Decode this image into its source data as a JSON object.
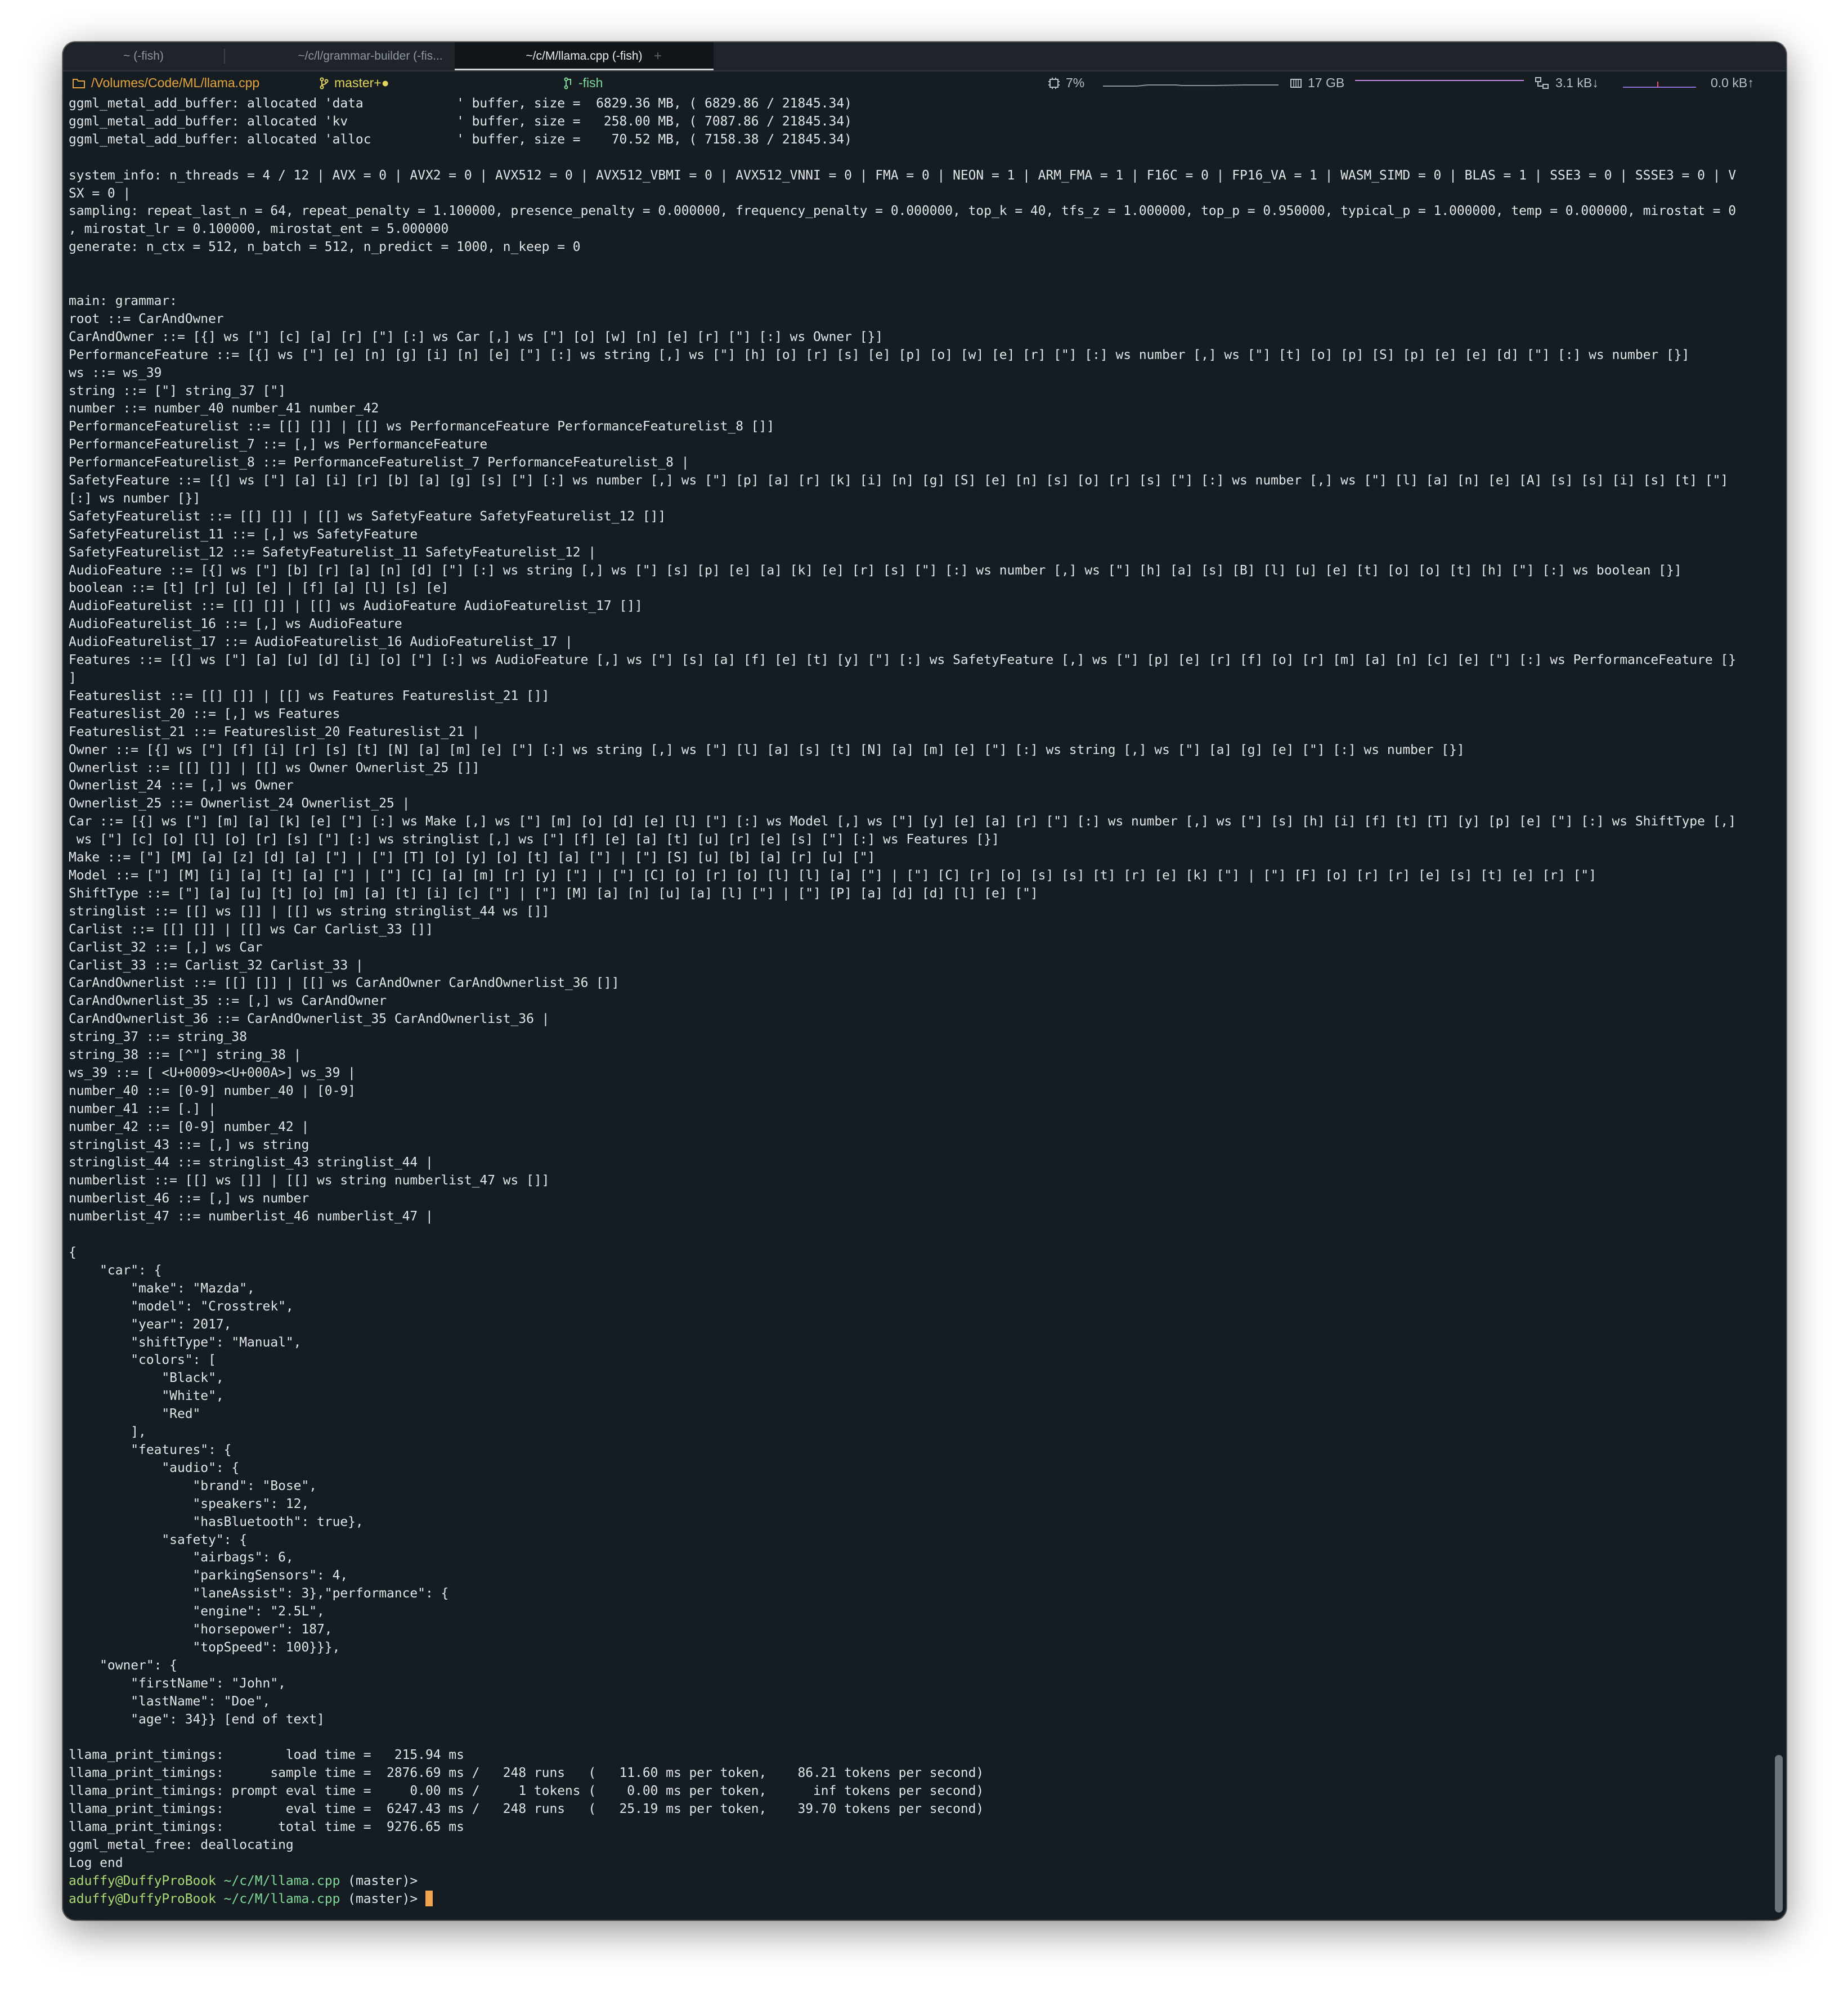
{
  "tabs": [
    {
      "label": "~ (-fish)",
      "active": false
    },
    {
      "label": "~/c/l/grammar-builder (-fis...",
      "active": false
    },
    {
      "label": "~/c/M/llama.cpp (-fish)",
      "active": true
    }
  ],
  "new_tab_label": "+",
  "status": {
    "path": "/Volumes/Code/ML/llama.cpp",
    "git": "master+●",
    "process": "-fish",
    "cpu": "7%",
    "memory": "17 GB",
    "net_down": "3.1 kB↓",
    "net_up": "0.0 kB↑"
  },
  "terminal": {
    "lines": [
      "ggml_metal_add_buffer: allocated 'data            ' buffer, size =  6829.36 MB, ( 6829.86 / 21845.34)",
      "ggml_metal_add_buffer: allocated 'kv              ' buffer, size =   258.00 MB, ( 7087.86 / 21845.34)",
      "ggml_metal_add_buffer: allocated 'alloc           ' buffer, size =    70.52 MB, ( 7158.38 / 21845.34)",
      "",
      "system_info: n_threads = 4 / 12 | AVX = 0 | AVX2 = 0 | AVX512 = 0 | AVX512_VBMI = 0 | AVX512_VNNI = 0 | FMA = 0 | NEON = 1 | ARM_FMA = 1 | F16C = 0 | FP16_VA = 1 | WASM_SIMD = 0 | BLAS = 1 | SSE3 = 0 | SSSE3 = 0 | V",
      "SX = 0 |",
      "sampling: repeat_last_n = 64, repeat_penalty = 1.100000, presence_penalty = 0.000000, frequency_penalty = 0.000000, top_k = 40, tfs_z = 1.000000, top_p = 0.950000, typical_p = 1.000000, temp = 0.000000, mirostat = 0",
      ", mirostat_lr = 0.100000, mirostat_ent = 5.000000",
      "generate: n_ctx = 512, n_batch = 512, n_predict = 1000, n_keep = 0",
      "",
      "",
      "main: grammar:",
      "root ::= CarAndOwner",
      "CarAndOwner ::= [{] ws [\"] [c] [a] [r] [\"] [:] ws Car [,] ws [\"] [o] [w] [n] [e] [r] [\"] [:] ws Owner [}]",
      "PerformanceFeature ::= [{] ws [\"] [e] [n] [g] [i] [n] [e] [\"] [:] ws string [,] ws [\"] [h] [o] [r] [s] [e] [p] [o] [w] [e] [r] [\"] [:] ws number [,] ws [\"] [t] [o] [p] [S] [p] [e] [e] [d] [\"] [:] ws number [}]",
      "ws ::= ws_39",
      "string ::= [\"] string_37 [\"]",
      "number ::= number_40 number_41 number_42",
      "PerformanceFeaturelist ::= [[] []] | [[] ws PerformanceFeature PerformanceFeaturelist_8 []]",
      "PerformanceFeaturelist_7 ::= [,] ws PerformanceFeature",
      "PerformanceFeaturelist_8 ::= PerformanceFeaturelist_7 PerformanceFeaturelist_8 |",
      "SafetyFeature ::= [{] ws [\"] [a] [i] [r] [b] [a] [g] [s] [\"] [:] ws number [,] ws [\"] [p] [a] [r] [k] [i] [n] [g] [S] [e] [n] [s] [o] [r] [s] [\"] [:] ws number [,] ws [\"] [l] [a] [n] [e] [A] [s] [s] [i] [s] [t] [\"]",
      "[:] ws number [}]",
      "SafetyFeaturelist ::= [[] []] | [[] ws SafetyFeature SafetyFeaturelist_12 []]",
      "SafetyFeaturelist_11 ::= [,] ws SafetyFeature",
      "SafetyFeaturelist_12 ::= SafetyFeaturelist_11 SafetyFeaturelist_12 |",
      "AudioFeature ::= [{] ws [\"] [b] [r] [a] [n] [d] [\"] [:] ws string [,] ws [\"] [s] [p] [e] [a] [k] [e] [r] [s] [\"] [:] ws number [,] ws [\"] [h] [a] [s] [B] [l] [u] [e] [t] [o] [o] [t] [h] [\"] [:] ws boolean [}]",
      "boolean ::= [t] [r] [u] [e] | [f] [a] [l] [s] [e]",
      "AudioFeaturelist ::= [[] []] | [[] ws AudioFeature AudioFeaturelist_17 []]",
      "AudioFeaturelist_16 ::= [,] ws AudioFeature",
      "AudioFeaturelist_17 ::= AudioFeaturelist_16 AudioFeaturelist_17 |",
      "Features ::= [{] ws [\"] [a] [u] [d] [i] [o] [\"] [:] ws AudioFeature [,] ws [\"] [s] [a] [f] [e] [t] [y] [\"] [:] ws SafetyFeature [,] ws [\"] [p] [e] [r] [f] [o] [r] [m] [a] [n] [c] [e] [\"] [:] ws PerformanceFeature [}",
      "]",
      "Featureslist ::= [[] []] | [[] ws Features Featureslist_21 []]",
      "Featureslist_20 ::= [,] ws Features",
      "Featureslist_21 ::= Featureslist_20 Featureslist_21 |",
      "Owner ::= [{] ws [\"] [f] [i] [r] [s] [t] [N] [a] [m] [e] [\"] [:] ws string [,] ws [\"] [l] [a] [s] [t] [N] [a] [m] [e] [\"] [:] ws string [,] ws [\"] [a] [g] [e] [\"] [:] ws number [}]",
      "Ownerlist ::= [[] []] | [[] ws Owner Ownerlist_25 []]",
      "Ownerlist_24 ::= [,] ws Owner",
      "Ownerlist_25 ::= Ownerlist_24 Ownerlist_25 |",
      "Car ::= [{] ws [\"] [m] [a] [k] [e] [\"] [:] ws Make [,] ws [\"] [m] [o] [d] [e] [l] [\"] [:] ws Model [,] ws [\"] [y] [e] [a] [r] [\"] [:] ws number [,] ws [\"] [s] [h] [i] [f] [t] [T] [y] [p] [e] [\"] [:] ws ShiftType [,]",
      " ws [\"] [c] [o] [l] [o] [r] [s] [\"] [:] ws stringlist [,] ws [\"] [f] [e] [a] [t] [u] [r] [e] [s] [\"] [:] ws Features [}]",
      "Make ::= [\"] [M] [a] [z] [d] [a] [\"] | [\"] [T] [o] [y] [o] [t] [a] [\"] | [\"] [S] [u] [b] [a] [r] [u] [\"]",
      "Model ::= [\"] [M] [i] [a] [t] [a] [\"] | [\"] [C] [a] [m] [r] [y] [\"] | [\"] [C] [o] [r] [o] [l] [l] [a] [\"] | [\"] [C] [r] [o] [s] [s] [t] [r] [e] [k] [\"] | [\"] [F] [o] [r] [r] [e] [s] [t] [e] [r] [\"]",
      "ShiftType ::= [\"] [a] [u] [t] [o] [m] [a] [t] [i] [c] [\"] | [\"] [M] [a] [n] [u] [a] [l] [\"] | [\"] [P] [a] [d] [d] [l] [e] [\"]",
      "stringlist ::= [[] ws []] | [[] ws string stringlist_44 ws []]",
      "Carlist ::= [[] []] | [[] ws Car Carlist_33 []]",
      "Carlist_32 ::= [,] ws Car",
      "Carlist_33 ::= Carlist_32 Carlist_33 |",
      "CarAndOwnerlist ::= [[] []] | [[] ws CarAndOwner CarAndOwnerlist_36 []]",
      "CarAndOwnerlist_35 ::= [,] ws CarAndOwner",
      "CarAndOwnerlist_36 ::= CarAndOwnerlist_35 CarAndOwnerlist_36 |",
      "string_37 ::= string_38",
      "string_38 ::= [^\"] string_38 |",
      "ws_39 ::= [ <U+0009><U+000A>] ws_39 |",
      "number_40 ::= [0-9] number_40 | [0-9]",
      "number_41 ::= [.] |",
      "number_42 ::= [0-9] number_42 |",
      "stringlist_43 ::= [,] ws string",
      "stringlist_44 ::= stringlist_43 stringlist_44 |",
      "numberlist ::= [[] ws []] | [[] ws string numberlist_47 ws []]",
      "numberlist_46 ::= [,] ws number",
      "numberlist_47 ::= numberlist_46 numberlist_47 |",
      "",
      "{",
      "    \"car\": {",
      "        \"make\": \"Mazda\",",
      "        \"model\": \"Crosstrek\",",
      "        \"year\": 2017,",
      "        \"shiftType\": \"Manual\",",
      "        \"colors\": [",
      "            \"Black\",",
      "            \"White\",",
      "            \"Red\"",
      "        ],",
      "        \"features\": {",
      "            \"audio\": {",
      "                \"brand\": \"Bose\",",
      "                \"speakers\": 12,",
      "                \"hasBluetooth\": true},",
      "            \"safety\": {",
      "                \"airbags\": 6,",
      "                \"parkingSensors\": 4,",
      "                \"laneAssist\": 3},\"performance\": {",
      "                \"engine\": \"2.5L\",",
      "                \"horsepower\": 187,",
      "                \"topSpeed\": 100}}},",
      "    \"owner\": {",
      "        \"firstName\": \"John\",",
      "        \"lastName\": \"Doe\",",
      "        \"age\": 34}} [end of text]",
      "",
      "llama_print_timings:        load time =   215.94 ms",
      "llama_print_timings:      sample time =  2876.69 ms /   248 runs   (   11.60 ms per token,    86.21 tokens per second)",
      "llama_print_timings: prompt eval time =     0.00 ms /     1 tokens (    0.00 ms per token,      inf tokens per second)",
      "llama_print_timings:        eval time =  6247.43 ms /   248 runs   (   25.19 ms per token,    39.70 tokens per second)",
      "llama_print_timings:       total time =  9276.65 ms",
      "ggml_metal_free: deallocating",
      "Log end"
    ],
    "prompts": [
      {
        "user": "aduffy@DuffyProBook",
        "path": "~/c/M/llama.cpp",
        "branch": " (master)>",
        "cursor": false
      },
      {
        "user": "aduffy@DuffyProBook",
        "path": "~/c/M/llama.cpp",
        "branch": " (master)>",
        "cursor": true
      }
    ]
  },
  "colors": {
    "background": "#161d22",
    "text": "#dfe5e8",
    "prompt_user": "#a9dc76",
    "prompt_path": "#7dd99a",
    "cursor": "#f0a44f"
  },
  "icons": [
    "folder-icon",
    "git-branch-icon",
    "process-icon",
    "cpu-icon",
    "memory-icon",
    "network-icon"
  ]
}
